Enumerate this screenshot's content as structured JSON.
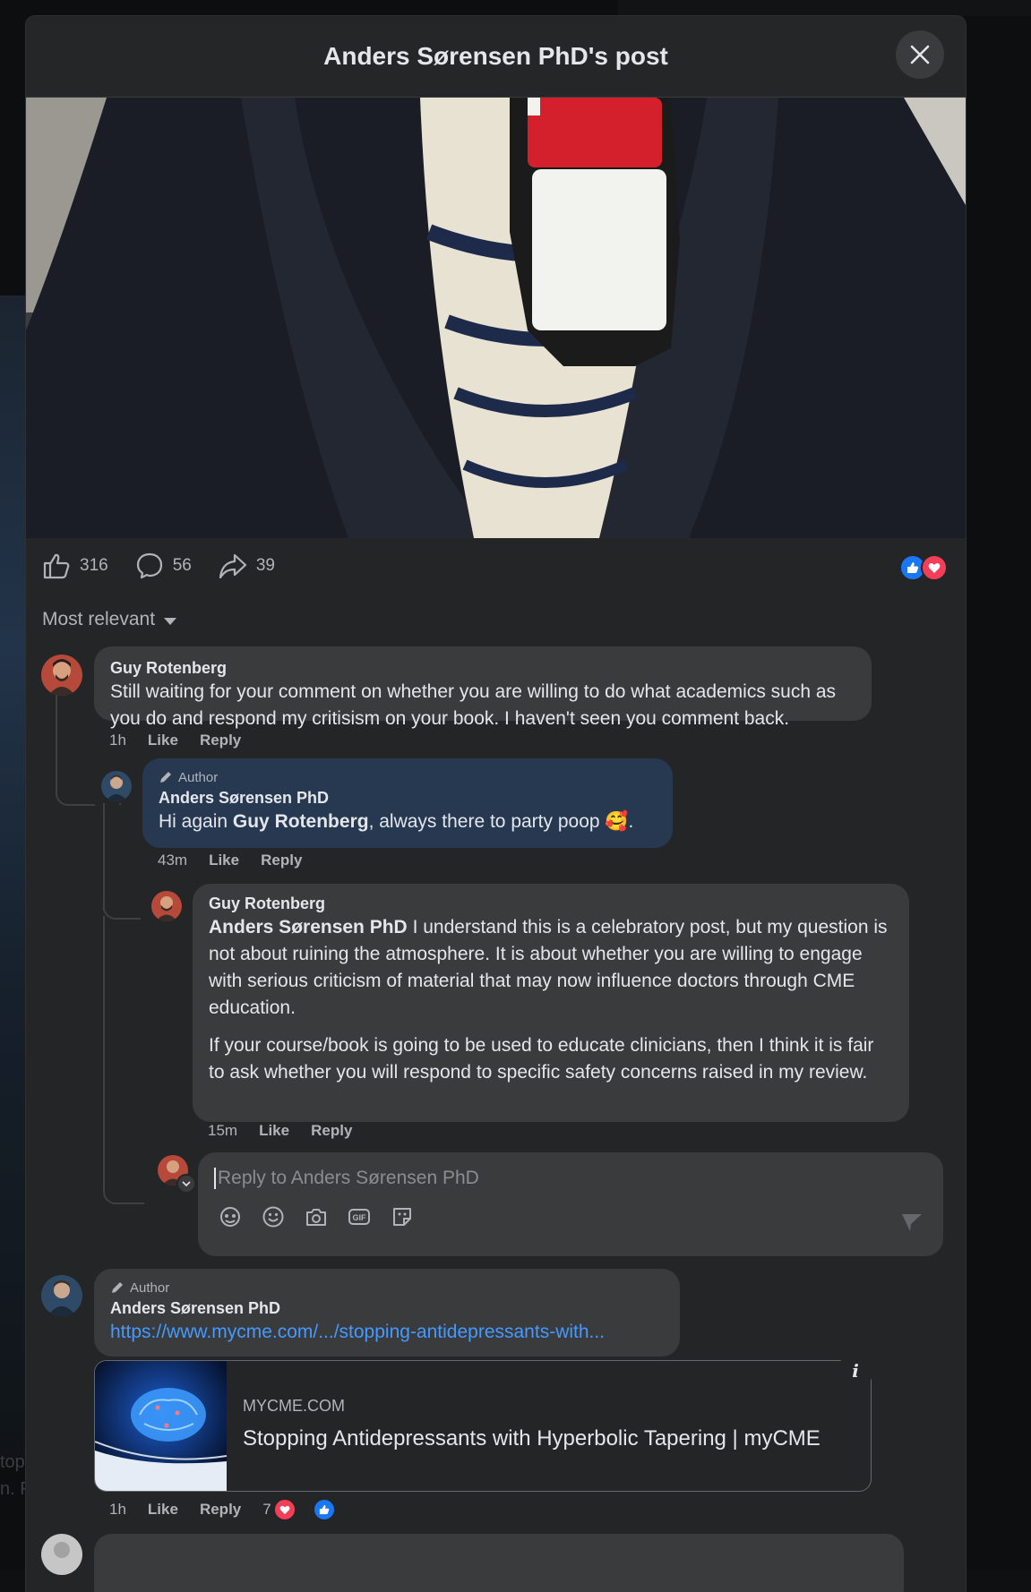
{
  "dialog": {
    "title": "Anders Sørensen PhD's post"
  },
  "stats": {
    "likes": "316",
    "comments": "56",
    "shares": "39"
  },
  "sort": {
    "label": "Most relevant"
  },
  "comments": [
    {
      "name": "Guy Rotenberg",
      "text": "Still waiting for your comment on whether you are willing to do what academics such as you do and respond my critisism on your book. I haven't seen you comment back.",
      "time": "1h",
      "like": "Like",
      "reply": "Reply"
    },
    {
      "tag": "Author",
      "name": "Anders Sørensen PhD",
      "text_pre": "Hi again ",
      "mention": "Guy Rotenberg",
      "text_post": ", always there to party poop 🥰.",
      "time": "43m",
      "like": "Like",
      "reply": "Reply"
    },
    {
      "name": "Guy Rotenberg",
      "mention": "Anders Sørensen PhD",
      "text_1": " I understand this is a celebratory post, but my question is not about ruining the atmosphere. It is about whether you are willing to engage with serious criticism of material that may now influence doctors through CME education.",
      "text_2": "If your course/book is going to be used to educate clinicians, then I think it is fair to ask whether you will respond to specific safety concerns raised in my review.",
      "time": "15m",
      "like": "Like",
      "reply": "Reply"
    },
    {
      "tag": "Author",
      "name": "Anders Sørensen PhD",
      "link": "https://www.mycme.com/.../stopping-antidepressants-with...",
      "card_domain": "MYCME.COM",
      "card_title": "Stopping Antidepressants with Hyperbolic Tapering | myCME",
      "time": "1h",
      "like": "Like",
      "reply": "Reply",
      "reaction_count": "7"
    }
  ],
  "reply_box": {
    "placeholder": "Reply to Anders Sørensen PhD"
  },
  "backdrop": {
    "text_1": "top",
    "text_2": "n. F"
  },
  "colors": {
    "dialog_bg": "#242526",
    "bubble_bg": "#3a3b3c",
    "author_bubble_bg": "#263951",
    "link": "#4599ff",
    "like_blue": "#1877f2",
    "love_red": "#f33e58"
  }
}
